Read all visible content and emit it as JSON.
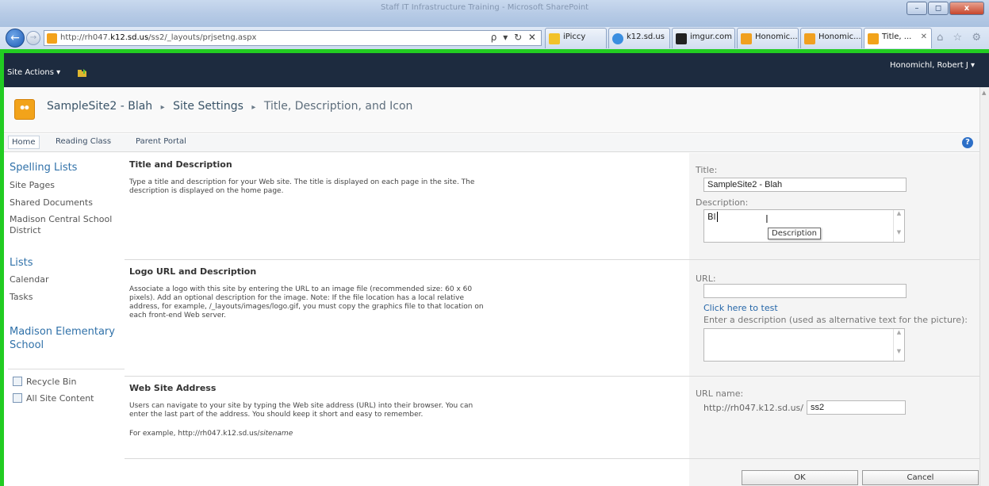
{
  "browser": {
    "window_title": "Staff IT Infrastructure Training - Microsoft SharePoint",
    "address": {
      "url_prefix": "http://rh047.",
      "url_host": "k12.sd.us",
      "url_path": "/ss2/_layouts/prjsetng.aspx",
      "tools": "ρ ▾ ↻ ✕"
    },
    "tabs": [
      {
        "label": "iPiccy",
        "color": "#f2c22a"
      },
      {
        "label": "k12.sd.us",
        "color": "#3a8ee0"
      },
      {
        "label": "imgur.com",
        "color": "#222222"
      },
      {
        "label": "Honomic...",
        "color": "#f0a020"
      },
      {
        "label": "Honomic...",
        "color": "#f0a020"
      },
      {
        "label": "Title, ...",
        "color": "#f2a31a"
      }
    ],
    "tab_close": "✕",
    "nav_icons": "⌂ ☆ ⚙",
    "window_buttons": {
      "minimize": "–",
      "maximize": "◻",
      "close": "x"
    }
  },
  "topbar": {
    "site_actions": "Site Actions ▾",
    "user": "Honomichl, Robert J ▾"
  },
  "breadcrumb": {
    "site": "SampleSite2 - Blah",
    "settings": "Site Settings",
    "page": "Title, Description, and Icon",
    "sep": "▸"
  },
  "topnav": {
    "items": [
      "Home",
      "Reading Class",
      "Parent Portal"
    ],
    "help": "?"
  },
  "quicklaunch": {
    "spelling_lists": "Spelling Lists",
    "site_pages": "Site Pages",
    "shared_documents": "Shared Documents",
    "madison_central": "Madison Central School District",
    "lists": "Lists",
    "calendar": "Calendar",
    "tasks": "Tasks",
    "madison_elementary": "Madison Elementary School",
    "recycle_bin": "Recycle Bin",
    "all_site_content": "All Site Content"
  },
  "sections": {
    "title_desc": {
      "heading": "Title and Description",
      "text": "Type a title and description for your Web site. The title is displayed on each page in the site. The description is displayed on the home page.",
      "title_label": "Title:",
      "title_value": "SampleSite2 - Blah",
      "desc_label": "Description:",
      "desc_value": "Bl",
      "tooltip": "Description",
      "ibeam": "I"
    },
    "logo": {
      "heading": "Logo URL and Description",
      "text": "Associate a logo with this site by entering the URL to an image file (recommended size: 60 x 60 pixels). Add an optional description for the image. Note: If the file location has a local relative address, for example, /_layouts/images/logo.gif, you must copy the graphics file to that location on each front-end Web server.",
      "url_label": "URL:",
      "url_value": "",
      "test_link": "Click here to test",
      "alt_label": "Enter a description (used as alternative text for the picture):",
      "alt_value": ""
    },
    "address": {
      "heading": "Web Site Address",
      "text": "Users can navigate to your site by typing the Web site address (URL) into their browser. You can enter the last part of the address. You should keep it short and easy to remember.",
      "example_prefix": "For example, http://rh047.k12.sd.us/",
      "example_suffix": "sitename",
      "url_name_label": "URL name:",
      "url_prefix": "http://rh047.k12.sd.us/",
      "url_value": "ss2"
    }
  },
  "buttons": {
    "ok": "OK",
    "cancel": "Cancel"
  }
}
